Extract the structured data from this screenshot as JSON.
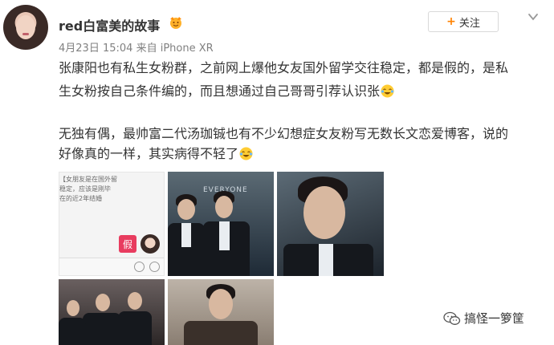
{
  "post": {
    "username": "red白富美的故事",
    "date": "4月23日 15:04",
    "source_prefix": "来自",
    "source": "iPhone XR",
    "follow_label": "关注",
    "paragraph1_line1": "张康阳也有私生女粉群，之前网上爆他女友国外留学交往稳定，都是假的，是私",
    "paragraph1_line2": "生女粉按自己条件编的，而且想通过自己哥哥引荐认识张",
    "paragraph2_line1": "无独有偶，最帅富二代汤珈铖也有不少幻想症女友粉写无数长文恋爱博客，说的",
    "paragraph2_line2": "好像真的一样，其实病得不轻了"
  },
  "images": {
    "chat_text": [
      "【女朋友是在国外留",
      "稳定，应该是刚毕",
      "在的近2年结婚"
    ],
    "chat_bubble": "假",
    "sign_text": "EVERYONE"
  },
  "icons": {
    "vip": "vip-badge-icon",
    "dropdown": "chevron-down-icon",
    "emoji": "laugh-cry-emoji-icon",
    "credit": "wechat-icon"
  },
  "credit": {
    "label": "搞怪一箩筐"
  },
  "colors": {
    "accent": "#ff8200",
    "text": "#333333",
    "meta": "#808080"
  }
}
